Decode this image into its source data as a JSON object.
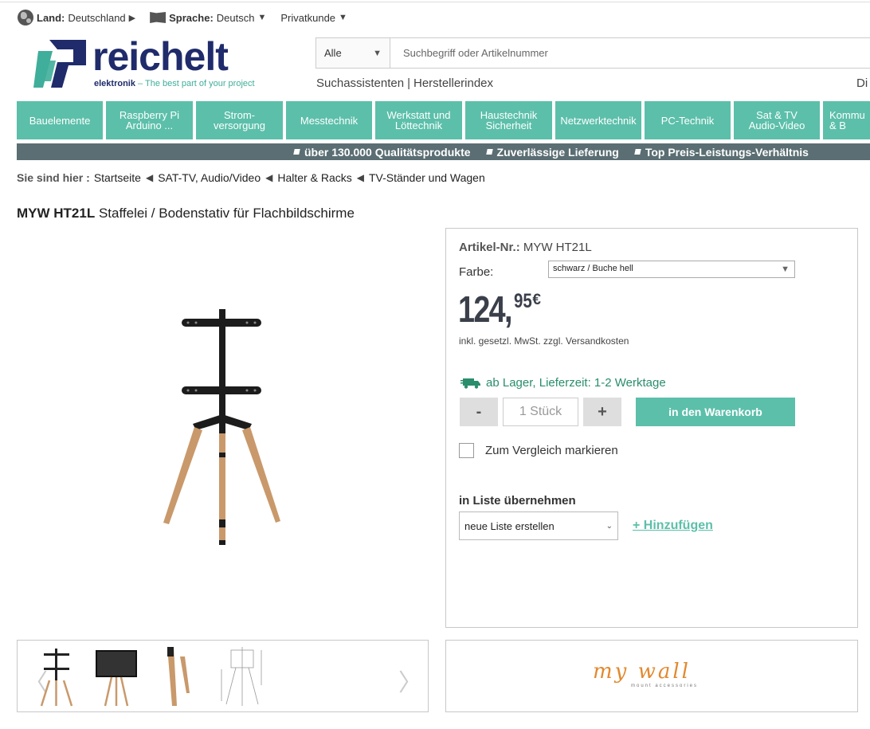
{
  "top_meta": {
    "land_label": "Land:",
    "land_value": "Deutschland",
    "sprache_label": "Sprache:",
    "sprache_value": "Deutsch",
    "kunde": "Privatkunde"
  },
  "logo": {
    "name": "reichelt",
    "sub_a": "elektronik",
    "sub_b": " – The best part of your project"
  },
  "search": {
    "category": "Alle",
    "placeholder": "Suchbegriff oder Artikelnummer"
  },
  "links": {
    "a": "Suchassistenten",
    "sep": "|",
    "b": "Herstellerindex",
    "right": "Di"
  },
  "nav": [
    "Bauelemente",
    "Raspberry Pi\nArduino ...",
    "Strom-\nversorgung",
    "Messtechnik",
    "Werkstatt und\nLöttechnik",
    "Haustechnik\nSicherheit",
    "Netzwerktechnik",
    "PC-Technik",
    "Sat & TV\nAudio-Video",
    "Kommu\n& B"
  ],
  "ribbon": [
    "über 130.000 Qualitätsprodukte",
    "Zuverlässige Lieferung",
    "Top Preis-Leistungs-Verhältnis"
  ],
  "breadcrumb": {
    "label": "Sie sind hier :",
    "items": [
      "Startseite",
      "SAT-TV, Audio/Video",
      "Halter & Racks",
      "TV-Ständer und Wagen"
    ]
  },
  "product": {
    "code": "MYW HT21L",
    "name": "Staffelei / Bodenstativ für Flachbildschirme",
    "artikel_label": "Artikel-Nr.:",
    "artikel_value": "MYW HT21L",
    "farbe_label": "Farbe:",
    "farbe_value": "schwarz / Buche hell",
    "price_big": "124,",
    "price_cents": "95",
    "currency": "€",
    "vat_note": "inkl. gesetzl. MwSt. zzgl. Versandkosten",
    "stock": "ab Lager, Lieferzeit: 1-2 Werktage",
    "qty_minus": "-",
    "qty_value": "1 Stück",
    "qty_plus": "+",
    "cart": "in den Warenkorb",
    "compare": "Zum Vergleich markieren",
    "list_label": "in Liste übernehmen",
    "list_select": "neue Liste erstellen",
    "add": "+ Hinzufügen"
  },
  "brand": {
    "logo": "my wall",
    "tagline": "mount accessories"
  },
  "colors": {
    "accent": "#5cbfaa",
    "ribbon": "#5a6e73",
    "logo_blue": "#1f2b6b",
    "stock_green": "#2a8d6b"
  }
}
